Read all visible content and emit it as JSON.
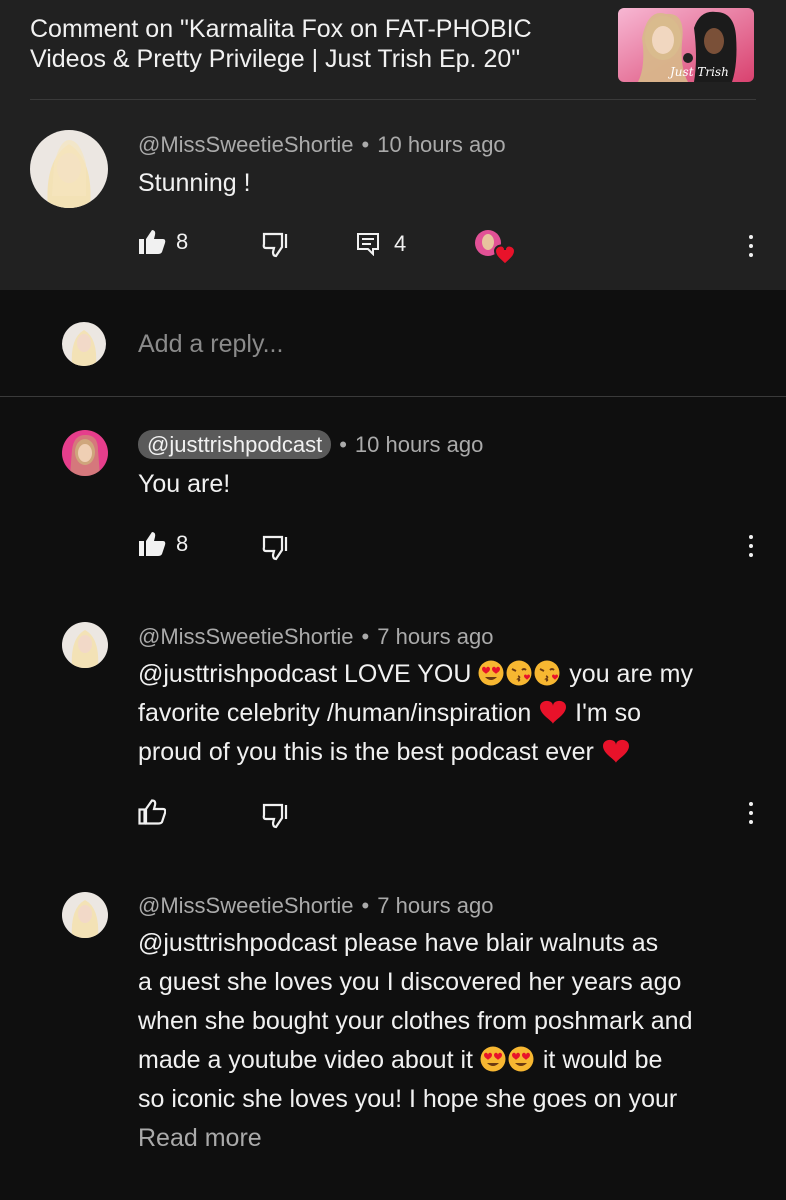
{
  "header": {
    "title": "Comment on \"Karmalita Fox on FAT-PHOBIC Videos & Pretty Privilege | Just Trish Ep. 20\""
  },
  "thumbnail_text": "Just Trish",
  "comment": {
    "author": "@MissSweetieShortie",
    "time": "10 hours ago",
    "text": "Stunning !",
    "likes": "8",
    "replies": "4"
  },
  "reply_input": {
    "placeholder": "Add a reply..."
  },
  "replies": [
    {
      "author": "@justtrishpodcast",
      "time": "10 hours ago",
      "text": "You are!",
      "likes": "8"
    },
    {
      "author": "@MissSweetieShortie",
      "time": "7 hours ago",
      "line1_a": "@justtrishpodcast  LOVE YOU ",
      "line1_b": " you are my",
      "line2_a": "favorite celebrity /human/inspiration ",
      "line2_b": "  I'm so",
      "line3": "proud of you this is the best podcast ever "
    },
    {
      "author": "@MissSweetieShortie",
      "time": "7 hours ago",
      "line1": "@justtrishpodcast  please have blair walnuts as",
      "line2": "a guest she loves you I discovered her years ago",
      "line3": "when she bought your clothes from poshmark and",
      "line4_a": "made a youtube video about it ",
      "line4_b": " it would be",
      "line5": "so iconic she loves you! I hope she goes on your",
      "read_more": "Read more"
    }
  ],
  "separator": "•",
  "icons": [
    "like-icon",
    "dislike-icon",
    "reply-icon",
    "creator-heart-icon",
    "more-vert-icon"
  ],
  "colors": {
    "top_panel": "#212121",
    "page_bg": "#0f0f0f",
    "meta_text": "#aaaaaa",
    "heart": "#e8122a",
    "pill_bg": "#5a5a5a"
  }
}
